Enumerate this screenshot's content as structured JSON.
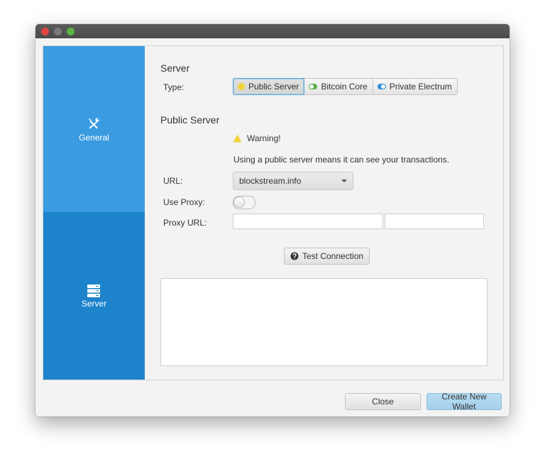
{
  "window": {
    "controls": [
      "close",
      "minimize",
      "maximize"
    ]
  },
  "sidebar": {
    "items": [
      {
        "label": "General",
        "icon": "tools-icon",
        "selected": false,
        "color": "#3a9be0"
      },
      {
        "label": "Server",
        "icon": "server-icon",
        "selected": true,
        "color": "#1d84cc"
      }
    ]
  },
  "server": {
    "title": "Server",
    "type_label": "Type:",
    "types": [
      {
        "label": "Public Server",
        "indicator": "yellow",
        "selected": true
      },
      {
        "label": "Bitcoin Core",
        "indicator": "green",
        "selected": false
      },
      {
        "label": "Private Electrum",
        "indicator": "blue",
        "selected": false
      }
    ]
  },
  "public_server": {
    "title": "Public Server",
    "warning_title": "Warning!",
    "warning_message": "Using a public server means it can see your transactions.",
    "url_label": "URL:",
    "url_value": "blockstream.info",
    "use_proxy_label": "Use Proxy:",
    "use_proxy_enabled": false,
    "proxy_url_label": "Proxy URL:",
    "proxy_host_value": "",
    "proxy_port_value": "",
    "test_connection_label": "Test Connection",
    "output_text": ""
  },
  "footer": {
    "close_label": "Close",
    "create_label": "Create New Wallet"
  },
  "colors": {
    "accent": "#3a9be0",
    "accent_dark": "#1d84cc",
    "warning": "#f2d43a",
    "primary_button": "#a9d3ee"
  }
}
